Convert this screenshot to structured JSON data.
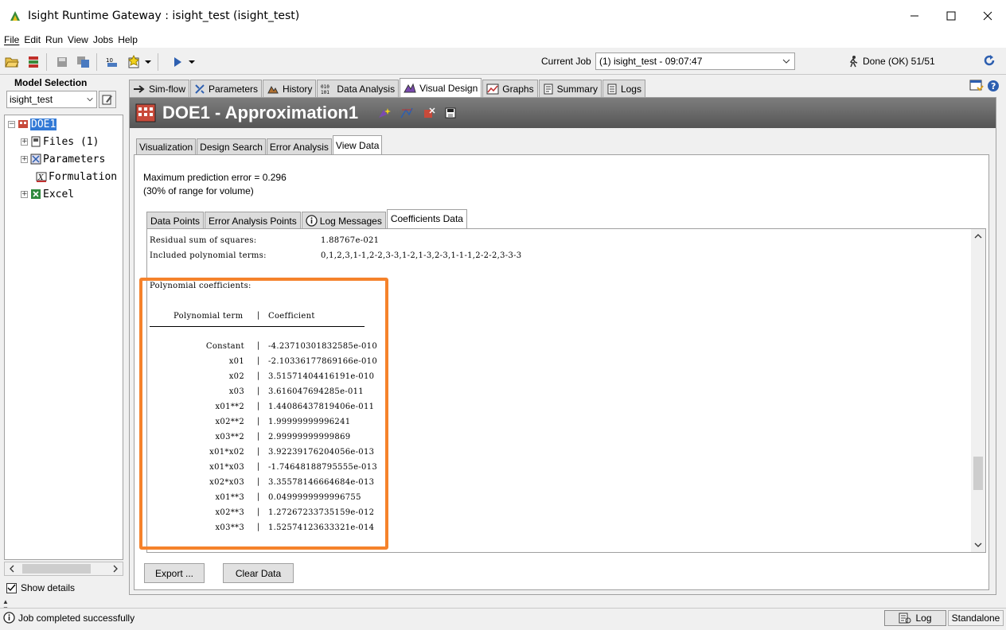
{
  "window": {
    "title": "Isight Runtime Gateway : isight_test (isight_test)"
  },
  "menu": [
    "File",
    "Edit",
    "Run",
    "View",
    "Jobs",
    "Help"
  ],
  "toolbar": {
    "current_job_label": "Current Job",
    "current_job_value": "(1) isight_test - 09:07:47",
    "status": "Done (OK) 51/51"
  },
  "model_selection": {
    "label": "Model Selection",
    "value": "isight_test"
  },
  "tree": {
    "root": "DOE1",
    "items": [
      "Files (1)",
      "Parameters",
      "Formulation",
      "Excel"
    ]
  },
  "show_details_label": "Show details",
  "main_tabs": [
    "Sim-flow",
    "Parameters",
    "History",
    "Data Analysis",
    "Visual Design",
    "Graphs",
    "Summary",
    "Logs"
  ],
  "header": {
    "title": "DOE1 - Approximation1"
  },
  "sub_tabs": [
    "Visualization",
    "Design Search",
    "Error Analysis",
    "View Data"
  ],
  "max_error": {
    "line1": "Maximum prediction error = 0.296",
    "line2": "(30% of range for volume)"
  },
  "inner_tabs": [
    "Data Points",
    "Error Analysis Points",
    "Log Messages",
    "Coefficients Data"
  ],
  "coefficients": {
    "residual_label": "Residual sum of squares:",
    "residual_value": "1.88767e-021",
    "included_label": "Included polynomial terms:",
    "included_value": "0,1,2,3,1-1,2-2,3-3,1-2,1-3,2-3,1-1-1,2-2-2,3-3-3",
    "poly_label": "Polynomial coefficients:",
    "col_term": "Polynomial term",
    "col_coef": "Coefficient",
    "rows": [
      {
        "term": "Constant",
        "coef": "-4.23710301832585e-010"
      },
      {
        "term": "x01",
        "coef": "-2.10336177869166e-010"
      },
      {
        "term": "x02",
        "coef": "3.51571404416191e-010"
      },
      {
        "term": "x03",
        "coef": "3.616047694285e-011"
      },
      {
        "term": "x01**2",
        "coef": "1.44086437819406e-011"
      },
      {
        "term": "x02**2",
        "coef": "1.99999999996241"
      },
      {
        "term": "x03**2",
        "coef": "2.99999999999869"
      },
      {
        "term": "x01*x02",
        "coef": "3.92239176204056e-013"
      },
      {
        "term": "x01*x03",
        "coef": "-1.74648188795555e-013"
      },
      {
        "term": "x02*x03",
        "coef": "3.35578146664684e-013"
      },
      {
        "term": "x01**3",
        "coef": "0.0499999999996755"
      },
      {
        "term": "x02**3",
        "coef": "1.27267233735159e-012"
      },
      {
        "term": "x03**3",
        "coef": "1.52574123633321e-014"
      }
    ]
  },
  "buttons": {
    "export": "Export ...",
    "clear": "Clear Data"
  },
  "statusbar": {
    "message": "Job completed successfully",
    "log": "Log",
    "mode": "Standalone"
  },
  "colors": {
    "highlight": "#f5822b",
    "selection": "#3179d6",
    "header_band": "#666666"
  }
}
